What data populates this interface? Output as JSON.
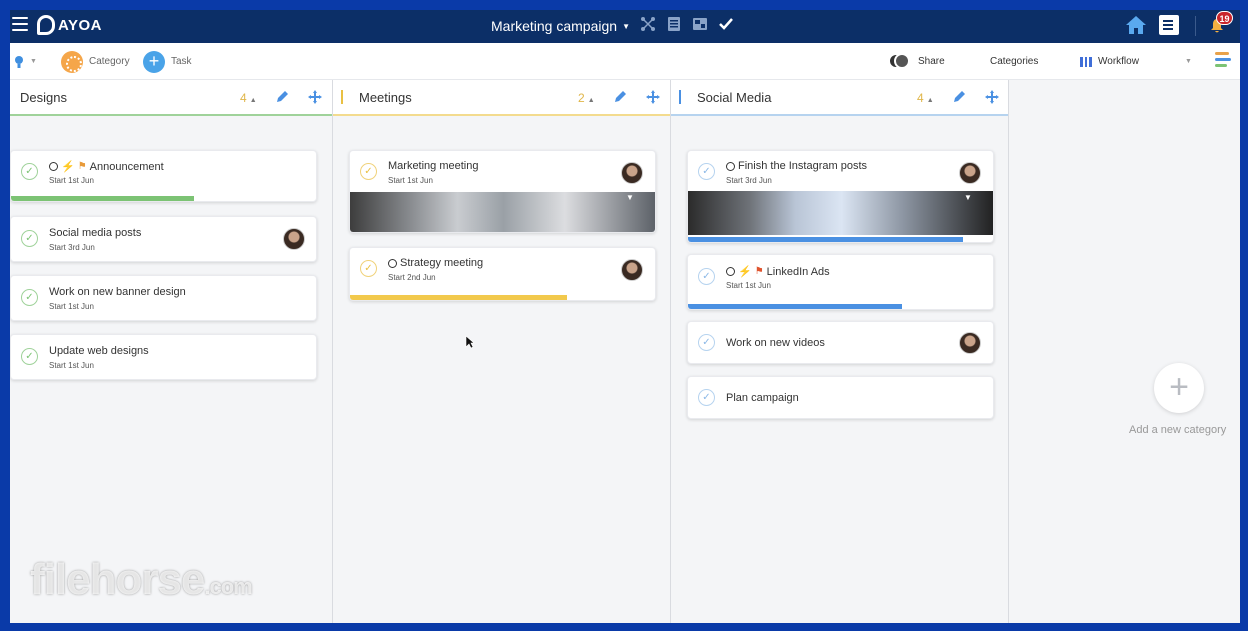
{
  "app": {
    "logo_text": "AYOA",
    "board_title": "Marketing campaign",
    "notification_count": "19",
    "view_icons": [
      "mindmap-icon",
      "list-icon",
      "canvas-icon",
      "tasks-icon"
    ]
  },
  "toolbar": {
    "category_label": "Category",
    "task_label": "Task",
    "share_label": "Share",
    "categories_label": "Categories",
    "workflow_label": "Workflow"
  },
  "columns": [
    {
      "title": "Designs",
      "count": "4",
      "accent": "#7cc374",
      "cards": [
        {
          "title": "Announcement",
          "sub": "Start 1st Jun",
          "icons": [
            "repeat-icon",
            "bolt-icon",
            "flag-icon"
          ],
          "progress": 0.6,
          "progress_color": "#7cc374",
          "avatar": false,
          "image": false
        },
        {
          "title": "Social media posts",
          "sub": "Start 3rd Jun",
          "icons": [],
          "avatar": true,
          "image": false
        },
        {
          "title": "Work on new banner design",
          "sub": "Start 1st Jun",
          "icons": [],
          "avatar": false,
          "image": false
        },
        {
          "title": "Update web designs",
          "sub": "Start 1st Jun",
          "icons": [],
          "avatar": false,
          "image": false
        }
      ]
    },
    {
      "title": "Meetings",
      "count": "2",
      "accent": "#e9c043",
      "cards": [
        {
          "title": "Marketing meeting",
          "sub": "Start 1st Jun",
          "icons": [],
          "avatar": true,
          "image": true
        },
        {
          "title": "Strategy meeting",
          "sub": "Start 2nd Jun",
          "icons": [
            "repeat-icon"
          ],
          "avatar": true,
          "image": false,
          "progress": 0.71,
          "progress_color": "#f2c94c"
        }
      ]
    },
    {
      "title": "Social Media",
      "count": "4",
      "accent": "#4a90e2",
      "cards": [
        {
          "title": "Finish the Instagram posts",
          "sub": "Start 3rd Jun",
          "icons": [
            "repeat-icon"
          ],
          "avatar": true,
          "image": true,
          "progress": 0.9,
          "progress_color": "#4a90e2"
        },
        {
          "title": "LinkedIn Ads",
          "sub": "Start 1st Jun",
          "icons": [
            "repeat-icon",
            "bolt-icon",
            "flag-icon"
          ],
          "avatar": false,
          "image": false,
          "progress": 0.7,
          "progress_color": "#4a90e2"
        },
        {
          "title": "Work on new videos",
          "sub": "",
          "icons": [],
          "avatar": true,
          "image": false
        },
        {
          "title": "Plan campaign",
          "sub": "",
          "icons": [],
          "avatar": false,
          "image": false
        }
      ]
    }
  ],
  "add_category_label": "Add a new category",
  "watermark": {
    "main": "filehorse",
    "suffix": ".com"
  }
}
